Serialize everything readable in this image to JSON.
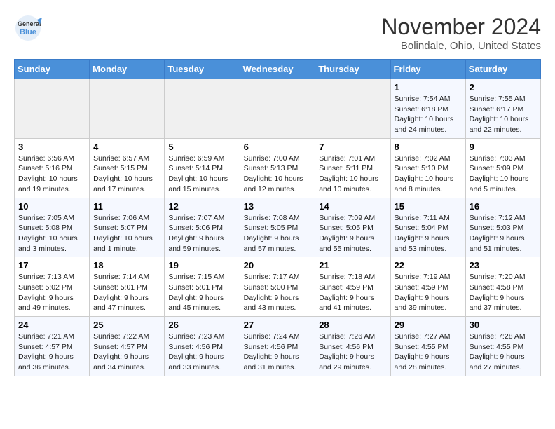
{
  "header": {
    "logo_line1": "General",
    "logo_line2": "Blue",
    "month": "November 2024",
    "location": "Bolindale, Ohio, United States"
  },
  "days_of_week": [
    "Sunday",
    "Monday",
    "Tuesday",
    "Wednesday",
    "Thursday",
    "Friday",
    "Saturday"
  ],
  "weeks": [
    [
      {
        "day": "",
        "detail": ""
      },
      {
        "day": "",
        "detail": ""
      },
      {
        "day": "",
        "detail": ""
      },
      {
        "day": "",
        "detail": ""
      },
      {
        "day": "",
        "detail": ""
      },
      {
        "day": "1",
        "detail": "Sunrise: 7:54 AM\nSunset: 6:18 PM\nDaylight: 10 hours and 24 minutes."
      },
      {
        "day": "2",
        "detail": "Sunrise: 7:55 AM\nSunset: 6:17 PM\nDaylight: 10 hours and 22 minutes."
      }
    ],
    [
      {
        "day": "3",
        "detail": "Sunrise: 6:56 AM\nSunset: 5:16 PM\nDaylight: 10 hours and 19 minutes."
      },
      {
        "day": "4",
        "detail": "Sunrise: 6:57 AM\nSunset: 5:15 PM\nDaylight: 10 hours and 17 minutes."
      },
      {
        "day": "5",
        "detail": "Sunrise: 6:59 AM\nSunset: 5:14 PM\nDaylight: 10 hours and 15 minutes."
      },
      {
        "day": "6",
        "detail": "Sunrise: 7:00 AM\nSunset: 5:13 PM\nDaylight: 10 hours and 12 minutes."
      },
      {
        "day": "7",
        "detail": "Sunrise: 7:01 AM\nSunset: 5:11 PM\nDaylight: 10 hours and 10 minutes."
      },
      {
        "day": "8",
        "detail": "Sunrise: 7:02 AM\nSunset: 5:10 PM\nDaylight: 10 hours and 8 minutes."
      },
      {
        "day": "9",
        "detail": "Sunrise: 7:03 AM\nSunset: 5:09 PM\nDaylight: 10 hours and 5 minutes."
      }
    ],
    [
      {
        "day": "10",
        "detail": "Sunrise: 7:05 AM\nSunset: 5:08 PM\nDaylight: 10 hours and 3 minutes."
      },
      {
        "day": "11",
        "detail": "Sunrise: 7:06 AM\nSunset: 5:07 PM\nDaylight: 10 hours and 1 minute."
      },
      {
        "day": "12",
        "detail": "Sunrise: 7:07 AM\nSunset: 5:06 PM\nDaylight: 9 hours and 59 minutes."
      },
      {
        "day": "13",
        "detail": "Sunrise: 7:08 AM\nSunset: 5:05 PM\nDaylight: 9 hours and 57 minutes."
      },
      {
        "day": "14",
        "detail": "Sunrise: 7:09 AM\nSunset: 5:05 PM\nDaylight: 9 hours and 55 minutes."
      },
      {
        "day": "15",
        "detail": "Sunrise: 7:11 AM\nSunset: 5:04 PM\nDaylight: 9 hours and 53 minutes."
      },
      {
        "day": "16",
        "detail": "Sunrise: 7:12 AM\nSunset: 5:03 PM\nDaylight: 9 hours and 51 minutes."
      }
    ],
    [
      {
        "day": "17",
        "detail": "Sunrise: 7:13 AM\nSunset: 5:02 PM\nDaylight: 9 hours and 49 minutes."
      },
      {
        "day": "18",
        "detail": "Sunrise: 7:14 AM\nSunset: 5:01 PM\nDaylight: 9 hours and 47 minutes."
      },
      {
        "day": "19",
        "detail": "Sunrise: 7:15 AM\nSunset: 5:01 PM\nDaylight: 9 hours and 45 minutes."
      },
      {
        "day": "20",
        "detail": "Sunrise: 7:17 AM\nSunset: 5:00 PM\nDaylight: 9 hours and 43 minutes."
      },
      {
        "day": "21",
        "detail": "Sunrise: 7:18 AM\nSunset: 4:59 PM\nDaylight: 9 hours and 41 minutes."
      },
      {
        "day": "22",
        "detail": "Sunrise: 7:19 AM\nSunset: 4:59 PM\nDaylight: 9 hours and 39 minutes."
      },
      {
        "day": "23",
        "detail": "Sunrise: 7:20 AM\nSunset: 4:58 PM\nDaylight: 9 hours and 37 minutes."
      }
    ],
    [
      {
        "day": "24",
        "detail": "Sunrise: 7:21 AM\nSunset: 4:57 PM\nDaylight: 9 hours and 36 minutes."
      },
      {
        "day": "25",
        "detail": "Sunrise: 7:22 AM\nSunset: 4:57 PM\nDaylight: 9 hours and 34 minutes."
      },
      {
        "day": "26",
        "detail": "Sunrise: 7:23 AM\nSunset: 4:56 PM\nDaylight: 9 hours and 33 minutes."
      },
      {
        "day": "27",
        "detail": "Sunrise: 7:24 AM\nSunset: 4:56 PM\nDaylight: 9 hours and 31 minutes."
      },
      {
        "day": "28",
        "detail": "Sunrise: 7:26 AM\nSunset: 4:56 PM\nDaylight: 9 hours and 29 minutes."
      },
      {
        "day": "29",
        "detail": "Sunrise: 7:27 AM\nSunset: 4:55 PM\nDaylight: 9 hours and 28 minutes."
      },
      {
        "day": "30",
        "detail": "Sunrise: 7:28 AM\nSunset: 4:55 PM\nDaylight: 9 hours and 27 minutes."
      }
    ]
  ]
}
